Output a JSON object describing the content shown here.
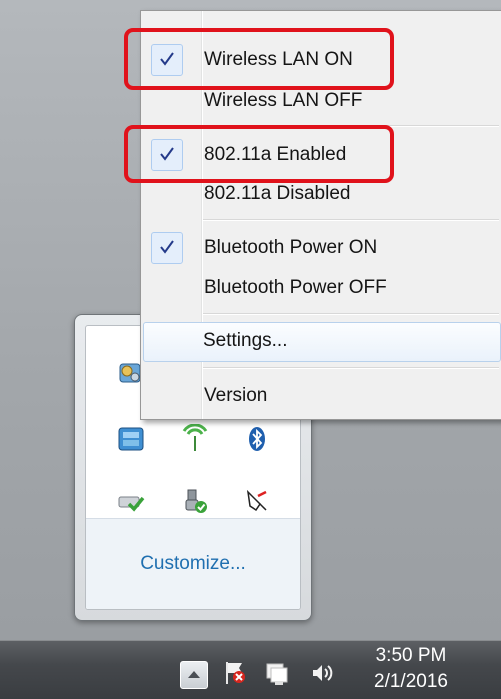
{
  "menu": {
    "items": [
      {
        "label": "Wireless LAN ON",
        "checked": true
      },
      {
        "label": "Wireless LAN OFF",
        "checked": false
      },
      {
        "label": "802.11a Enabled",
        "checked": true
      },
      {
        "label": "802.11a Disabled",
        "checked": false
      },
      {
        "label": "Bluetooth Power ON",
        "checked": true
      },
      {
        "label": "Bluetooth Power OFF",
        "checked": false
      },
      {
        "label": "Settings...",
        "checked": false
      },
      {
        "label": "Version",
        "checked": false
      }
    ]
  },
  "flyout": {
    "customize_label": "Customize...",
    "icons": [
      "gear-cluster-icon",
      "wireless-network-icon",
      "bluetooth-icon",
      "remote-access-icon",
      "network-check-icon",
      "usb-safely-remove-icon",
      "pen-tablet-icon"
    ]
  },
  "taskbar": {
    "time": "3:50 PM",
    "date": "2/1/2016",
    "icons": [
      "show-hidden-icons-icon",
      "action-center-flag-icon",
      "network-icon",
      "volume-icon"
    ]
  },
  "colors": {
    "highlight_red": "#e0121b",
    "link_blue": "#1f6fb0",
    "menu_background": "#f0f0f0"
  }
}
